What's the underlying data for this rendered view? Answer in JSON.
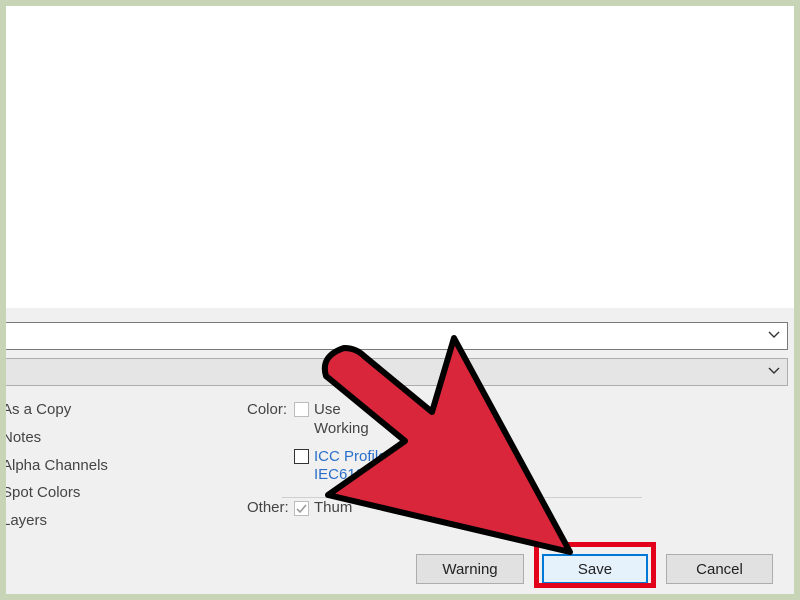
{
  "format_combo": {
    "value": ""
  },
  "options": [
    {
      "label": "As a Copy"
    },
    {
      "label": "Notes"
    },
    {
      "label": "Alpha Channels"
    },
    {
      "label": "Spot Colors"
    },
    {
      "label": "Layers"
    }
  ],
  "color": {
    "label": "Color:",
    "use_proof_line1": "Use",
    "use_proof_line2": "Working",
    "icc_line1": "ICC Profile:",
    "icc_line2": "IEC6196"
  },
  "other": {
    "label": "Other:",
    "thumbnail": "Thum",
    "thumbnail_checked": true
  },
  "buttons": {
    "warning": "Warning",
    "save": "Save",
    "cancel": "Cancel"
  },
  "colors": {
    "highlight": "#e3001b",
    "arrow_fill": "#d9263a",
    "link": "#2a6fc9",
    "save_border": "#0078d7"
  }
}
